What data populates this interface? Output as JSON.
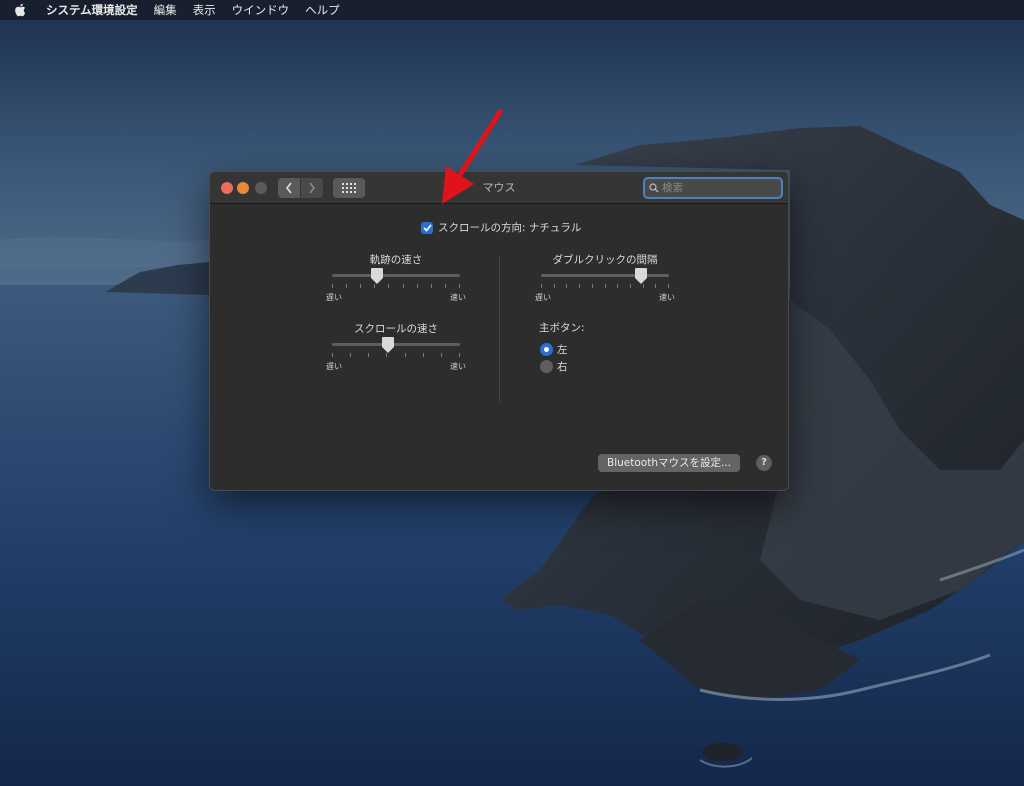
{
  "menubar": {
    "app_name": "システム環境設定",
    "items": [
      "編集",
      "表示",
      "ウインドウ",
      "ヘルプ"
    ]
  },
  "window": {
    "title": "マウス",
    "search_placeholder": "検索",
    "natural_scroll": {
      "label": "スクロールの方向: ナチュラル",
      "checked": true
    },
    "tracking_speed": {
      "title": "軌跡の速さ",
      "min_label": "遅い",
      "max_label": "速い",
      "level": 0.35
    },
    "scroll_speed": {
      "title": "スクロールの速さ",
      "min_label": "遅い",
      "max_label": "速い",
      "level": 0.44
    },
    "double_click": {
      "title": "ダブルクリックの間隔",
      "min_label": "遅い",
      "max_label": "速い",
      "level": 0.78
    },
    "primary_button": {
      "title": "主ボタン:",
      "options": [
        "左",
        "右"
      ],
      "selected": "左"
    },
    "bluetooth_button": "Bluetoothマウスを設定...",
    "help_button": "?"
  },
  "colors": {
    "accent": "#2a6fd6",
    "annotation_arrow": "#e0131a",
    "close": "#ec6a5e",
    "minimize": "#e8893a"
  }
}
